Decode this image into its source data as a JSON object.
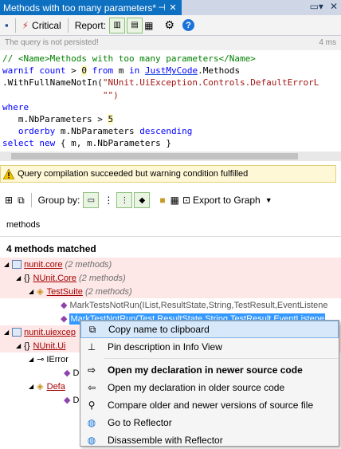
{
  "tab": {
    "title": "Methods with too many parameters*",
    "pin": "⊣",
    "close": "✕"
  },
  "toolbar": {
    "critical": "Critical",
    "report": "Report:"
  },
  "status": {
    "message": "The query is not persisted!",
    "time": "4 ms"
  },
  "warning": "Query compilation succeeded but warning condition fulfilled",
  "results_toolbar": {
    "group_by": "Group by:",
    "export": "Export to Graph"
  },
  "search_text": "methods",
  "match_count": "4 methods matched",
  "tree": [
    {
      "label": "nunit.core",
      "count": "(2 methods)"
    },
    {
      "label": "NUnit.Core",
      "count": "(2 methods)"
    },
    {
      "label": "TestSuite",
      "count": "(2 methods)"
    },
    {
      "label": "MarkTestsNotRun(IList,ResultState,String,TestResult,EventListene"
    },
    {
      "label": "MarkTestNotRun(Test,ResultState,String,TestResult,EventListene"
    },
    {
      "label": "nunit.uiexcep"
    },
    {
      "label": "NUnit.Ui"
    },
    {
      "label": "IError"
    },
    {
      "label": "D"
    },
    {
      "label": "Defa"
    },
    {
      "label": "D"
    }
  ],
  "menu": [
    {
      "label": "Copy name to clipboard",
      "icon": "copy-icon"
    },
    {
      "label": "Pin description in Info View",
      "icon": "pin-icon"
    },
    {
      "label": "Open my declaration in newer source code",
      "icon": "open-newer-icon"
    },
    {
      "label": "Open my declaration in older source code",
      "icon": "open-older-icon"
    },
    {
      "label": "Compare older and newer versions of source file",
      "icon": "compare-icon"
    },
    {
      "label": "Go to Reflector",
      "icon": "reflector-icon"
    },
    {
      "label": "Disassemble with Reflector",
      "icon": "disassemble-icon"
    }
  ]
}
